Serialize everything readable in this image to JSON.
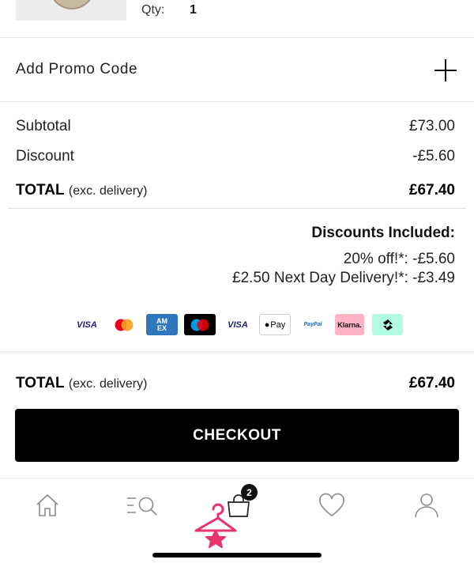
{
  "item": {
    "qty_label": "Qty:",
    "qty_value": "1"
  },
  "promo": {
    "label": "Add Promo Code",
    "expand_icon": "plus-icon"
  },
  "summary": {
    "subtotal_label": "Subtotal",
    "subtotal_value": "£73.00",
    "discount_label": "Discount",
    "discount_value": "-£5.60",
    "total_label": "TOTAL",
    "total_note": "(exc. delivery)",
    "total_value": "£67.40"
  },
  "discounts": {
    "heading": "Discounts Included:",
    "items": [
      "20% off!*: -£5.60",
      "£2.50 Next Day Delivery!*: -£3.49"
    ]
  },
  "payment_methods": [
    {
      "name": "visa-icon",
      "text": "VISA"
    },
    {
      "name": "mastercard-icon",
      "text": ""
    },
    {
      "name": "amex-icon",
      "text": "AM EX"
    },
    {
      "name": "maestro-icon",
      "text": ""
    },
    {
      "name": "visa-electron-icon",
      "text": "VISA"
    },
    {
      "name": "apple-pay-icon",
      "text": "Pay"
    },
    {
      "name": "paypal-icon",
      "text": "PayPal"
    },
    {
      "name": "klarna-icon",
      "text": "Klarna."
    },
    {
      "name": "afterpay-icon",
      "text": ""
    }
  ],
  "footer": {
    "total_label": "TOTAL",
    "total_note": "(exc. delivery)",
    "total_value": "£67.40",
    "checkout_label": "CHECKOUT"
  },
  "tabbar": {
    "items": [
      "home-icon",
      "search-menu-icon",
      "bag-icon",
      "heart-icon",
      "account-icon"
    ],
    "bag_count": "2"
  },
  "colors": {
    "brand_pink": "#e8336b",
    "button_bg": "#000000",
    "klarna_pink": "#ffb3c7",
    "afterpay_mint": "#b2fce4",
    "amex_blue": "#2e77bc"
  }
}
